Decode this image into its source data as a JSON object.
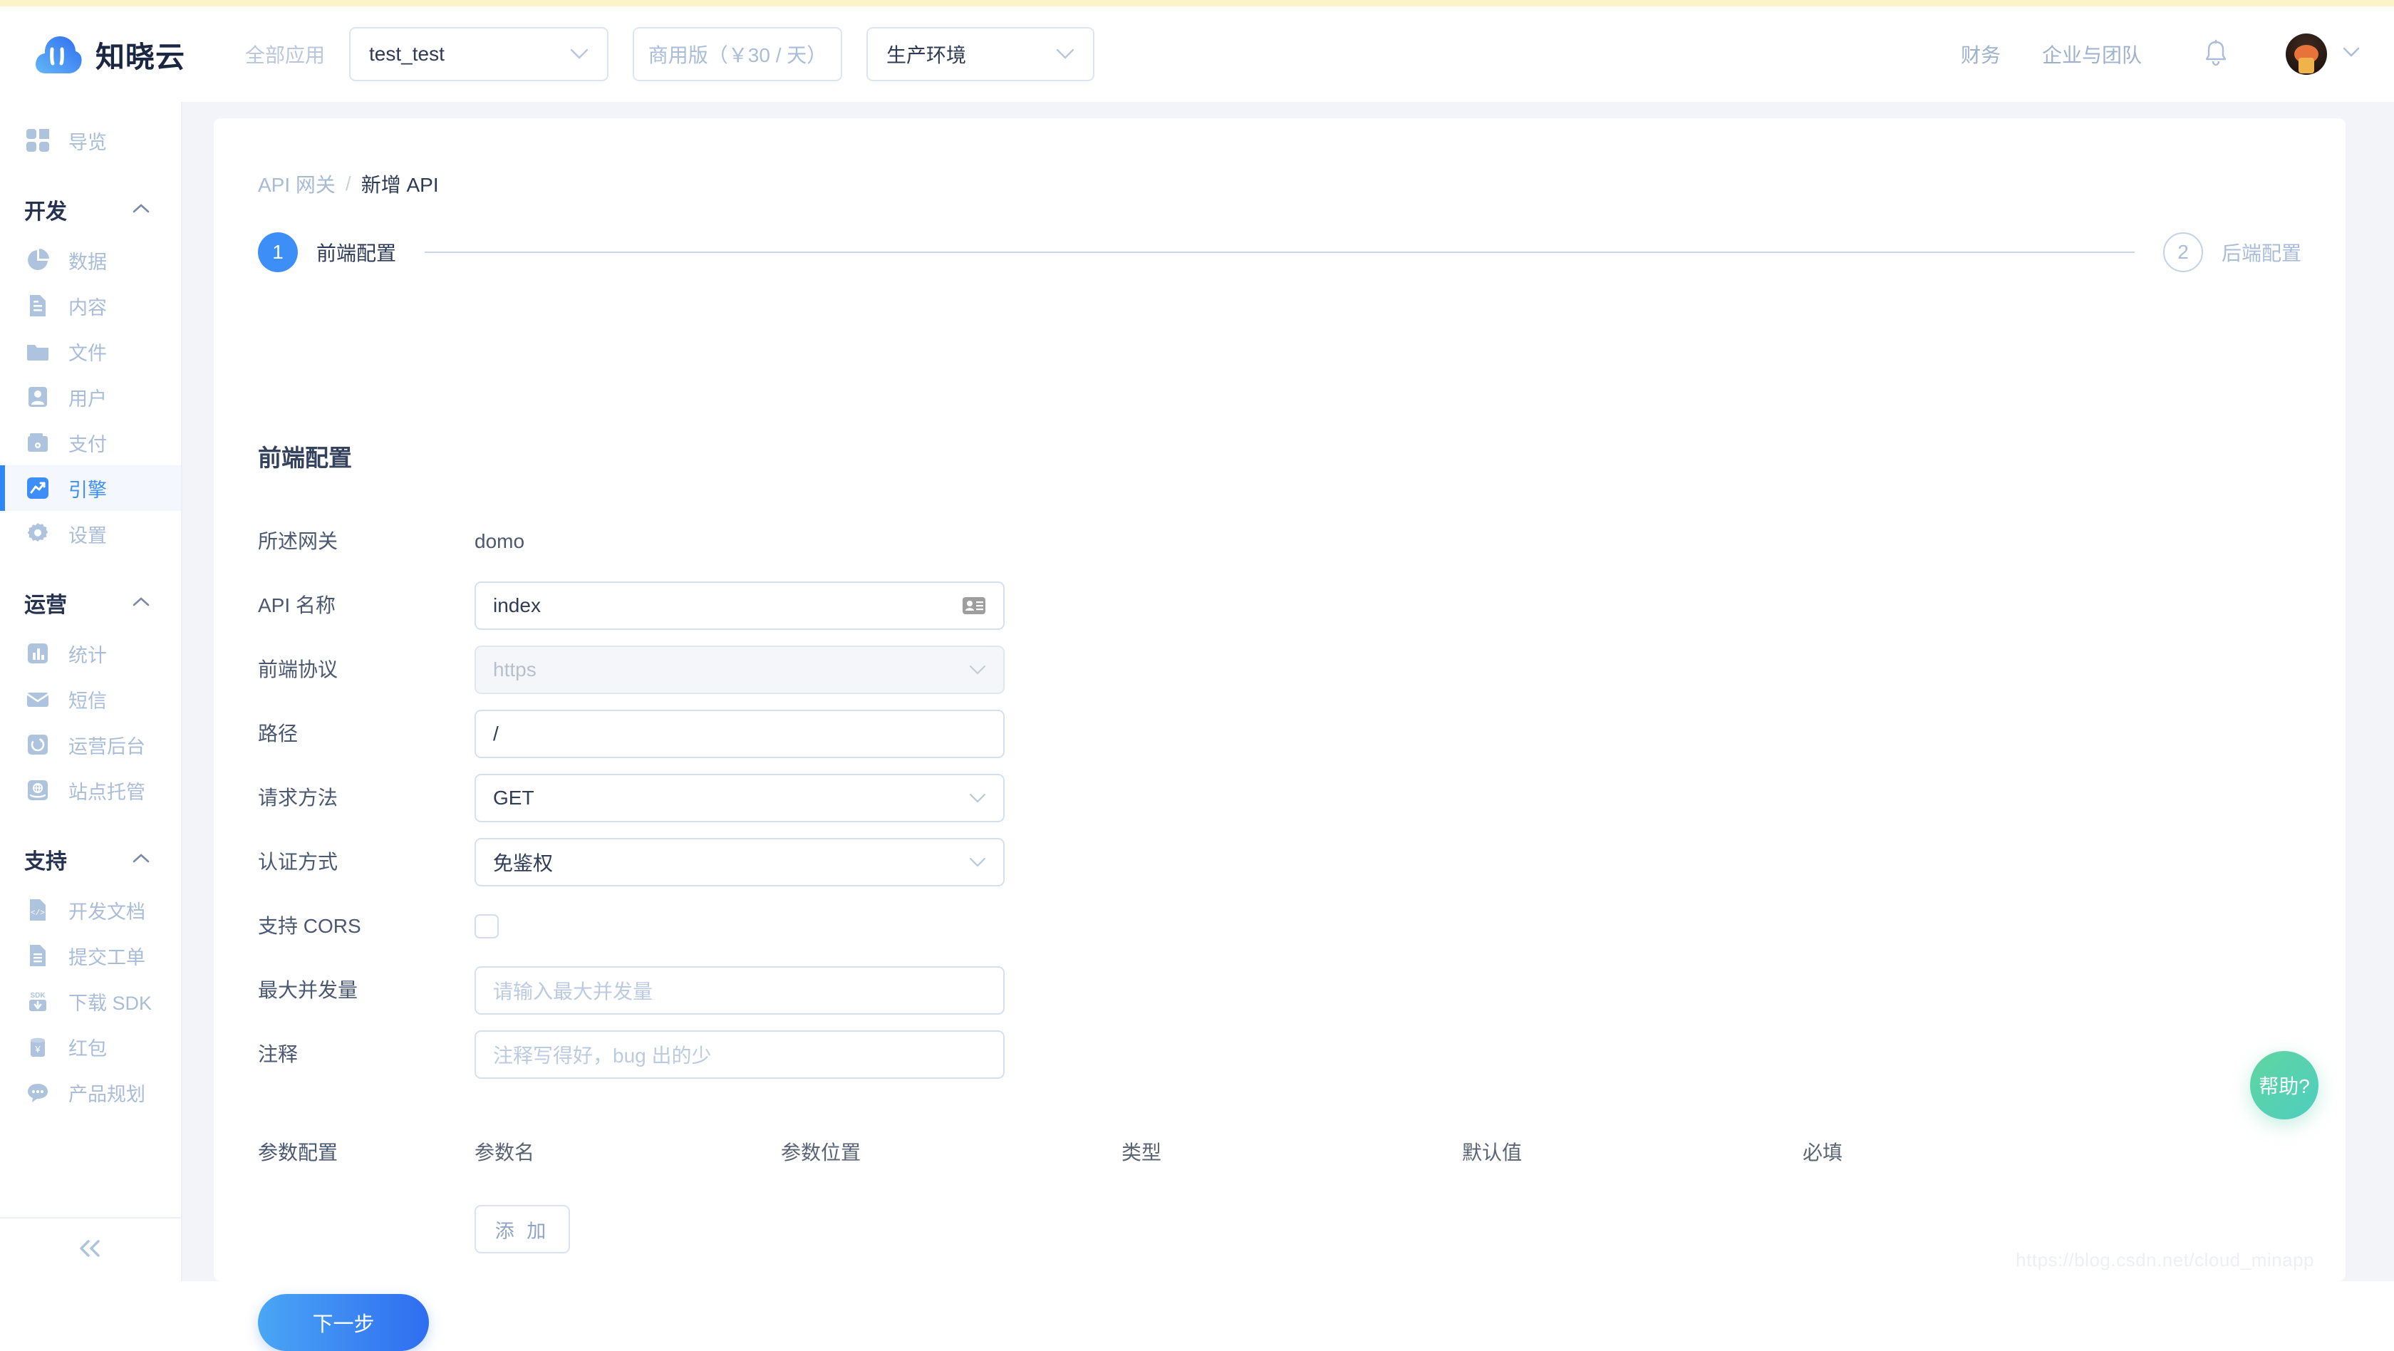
{
  "header": {
    "brand_name": "知晓云",
    "logo_icon": "cloud-logo-icon",
    "all_apps_label": "全部应用",
    "app_select": {
      "value": "test_test",
      "icon": "chevron-down-icon"
    },
    "plan_select": {
      "value": "商用版（￥30 / 天）",
      "icon": "chevron-down-icon"
    },
    "env_select": {
      "value": "生产环境",
      "icon": "chevron-down-icon"
    },
    "links": [
      {
        "label": "财务",
        "name": "finance"
      },
      {
        "label": "企业与团队",
        "name": "enterprise-team"
      }
    ],
    "bell_icon": "bell-icon",
    "avatar_icon": "user-avatar",
    "avatar_chevron": "chevron-down-icon"
  },
  "sidebar": {
    "overview": {
      "label": "导览",
      "icon": "grid-icon"
    },
    "groups": [
      {
        "title": "开发",
        "chevron": "chevron-up-icon",
        "items": [
          {
            "label": "数据",
            "icon": "pie-chart-icon",
            "active": false
          },
          {
            "label": "内容",
            "icon": "document-icon",
            "active": false
          },
          {
            "label": "文件",
            "icon": "folder-icon",
            "active": false
          },
          {
            "label": "用户",
            "icon": "user-icon",
            "active": false
          },
          {
            "label": "支付",
            "icon": "wallet-icon",
            "active": false
          },
          {
            "label": "引擎",
            "icon": "trend-up-icon",
            "active": true
          },
          {
            "label": "设置",
            "icon": "gear-icon",
            "active": false
          }
        ]
      },
      {
        "title": "运营",
        "chevron": "chevron-up-icon",
        "items": [
          {
            "label": "统计",
            "icon": "bar-chart-icon",
            "active": false
          },
          {
            "label": "短信",
            "icon": "envelope-icon",
            "active": false
          },
          {
            "label": "运营后台",
            "icon": "refresh-circle-icon",
            "active": false
          },
          {
            "label": "站点托管",
            "icon": "globe-hand-icon",
            "active": false
          }
        ]
      },
      {
        "title": "支持",
        "chevron": "chevron-up-icon",
        "items": [
          {
            "label": "开发文档",
            "icon": "code-file-icon",
            "active": false
          },
          {
            "label": "提交工单",
            "icon": "document-icon",
            "active": false
          },
          {
            "label": "下载 SDK",
            "icon": "sdk-download-icon",
            "active": false
          },
          {
            "label": "红包",
            "icon": "red-packet-icon",
            "active": false
          },
          {
            "label": "产品规划",
            "icon": "chat-bubble-icon",
            "active": false
          }
        ]
      }
    ],
    "collapse_icon": "double-chevron-left-icon"
  },
  "breadcrumb": {
    "root": "API 网关",
    "separator": "/",
    "current": "新增 API"
  },
  "steps": [
    {
      "num": "1",
      "label": "前端配置",
      "state": "active"
    },
    {
      "num": "2",
      "label": "后端配置",
      "state": "inactive"
    }
  ],
  "section_title": "前端配置",
  "form": {
    "gateway": {
      "label": "所述网关",
      "value": "domo"
    },
    "api_name": {
      "label": "API 名称",
      "value": "index",
      "icon": "id-card-icon"
    },
    "protocol": {
      "label": "前端协议",
      "value": "https",
      "disabled": true,
      "icon": "chevron-down-icon"
    },
    "path": {
      "label": "路径",
      "value": "/"
    },
    "method": {
      "label": "请求方法",
      "value": "GET",
      "icon": "chevron-down-icon"
    },
    "auth": {
      "label": "认证方式",
      "value": "免鉴权",
      "icon": "chevron-down-icon"
    },
    "cors": {
      "label": "支持 CORS",
      "checked": false
    },
    "max_concurrency": {
      "label": "最大并发量",
      "value": "",
      "placeholder": "请输入最大并发量"
    },
    "comment": {
      "label": "注释",
      "value": "",
      "placeholder": "注释写得好，bug 出的少"
    }
  },
  "params": {
    "label": "参数配置",
    "columns": [
      "参数名",
      "参数位置",
      "类型",
      "默认值",
      "必填"
    ],
    "rows": [],
    "add_label": "添 加"
  },
  "next_button": "下一步",
  "help_fab": "帮助?",
  "watermark": "https://blog.csdn.net/cloud_minapp",
  "colors": {
    "accent": "#3d8ef7",
    "accent_gradient_from": "#4aa6f5",
    "accent_gradient_to": "#2f6df0",
    "muted_text": "#a9bcd8",
    "dark_text": "#2c3a55",
    "page_bg": "#f2f4f9",
    "help_fab": "#5fd6a0",
    "top_strip": "#fdf3c9"
  }
}
